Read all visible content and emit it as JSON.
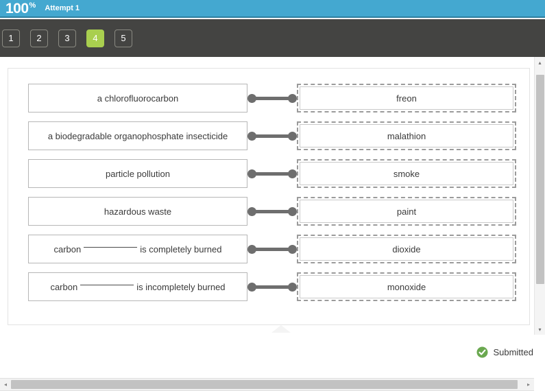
{
  "header": {
    "score": "100",
    "percent_symbol": "%",
    "attempt_label": "Attempt 1",
    "bg_color": "#44a8d0"
  },
  "tabs": {
    "bar_color": "#444442",
    "active_color": "#a9cf4f",
    "items": [
      {
        "label": "1",
        "active": false
      },
      {
        "label": "2",
        "active": false
      },
      {
        "label": "3",
        "active": false
      },
      {
        "label": "4",
        "active": true
      },
      {
        "label": "5",
        "active": false
      }
    ]
  },
  "matching": {
    "rows": [
      {
        "prompt": "a chlorofluorocarbon",
        "prompt_blank": false,
        "answer": "freon"
      },
      {
        "prompt": "a biodegradable organophosphate insecticide",
        "prompt_blank": false,
        "answer": "malathion"
      },
      {
        "prompt": "particle pollution",
        "prompt_blank": false,
        "answer": "smoke"
      },
      {
        "prompt": "hazardous waste",
        "prompt_blank": false,
        "answer": "paint"
      },
      {
        "prompt_prefix": "carbon",
        "prompt_suffix": "is completely burned",
        "prompt_blank": true,
        "answer": "dioxide"
      },
      {
        "prompt_prefix": "carbon",
        "prompt_suffix": "is incompletely burned",
        "prompt_blank": true,
        "answer": "monoxide"
      }
    ]
  },
  "scrollbars": {
    "h_left_arrow": "◂",
    "h_right_arrow": "▸",
    "v_up_arrow": "▴",
    "v_down_arrow": "▾"
  },
  "footer": {
    "status_text": "Submitted",
    "status_icon": "check-circle-icon",
    "status_color": "#6aa84f"
  }
}
